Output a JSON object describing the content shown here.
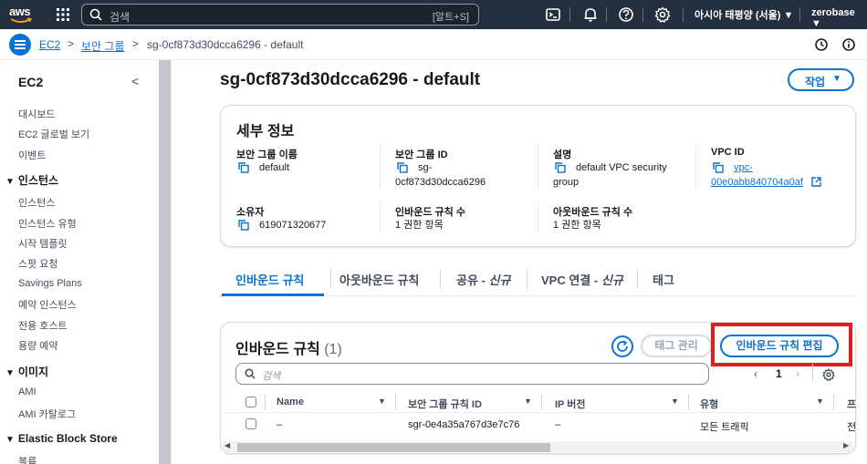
{
  "topnav": {
    "logo": "aws",
    "search_placeholder": "검색",
    "search_shortcut": "[알트+S]",
    "region": "아시아 태평양 (서울)",
    "account": "zerobase",
    "icons": [
      "grid-icon",
      "cloudshell-icon",
      "bell-icon",
      "help-icon",
      "gear-icon"
    ]
  },
  "breadcrumb": {
    "items": [
      "EC2",
      "보안 그룹",
      "sg-0cf873d30dcca6296 - default"
    ]
  },
  "sidebar": {
    "title": "EC2",
    "top_items": [
      "대시보드",
      "EC2 글로벌 보기",
      "이벤트"
    ],
    "sections": [
      {
        "label": "인스턴스",
        "items": [
          "인스턴스",
          "인스턴스 유형",
          "시작 템플릿",
          "스팟 요청",
          "Savings Plans",
          "예약 인스턴스",
          "전용 호스트",
          "용량 예약"
        ]
      },
      {
        "label": "이미지",
        "items": [
          "AMI",
          "AMI 카탈로그"
        ]
      },
      {
        "label": "Elastic Block Store",
        "items": [
          "볼륨"
        ]
      }
    ]
  },
  "main": {
    "title": "sg-0cf873d30dcca6296 - default",
    "action_button": "작업",
    "details": {
      "title": "세부 정보",
      "fields": [
        {
          "label": "보안 그룹 이름",
          "value": "default"
        },
        {
          "label": "보안 그룹 ID",
          "value_lines": [
            "sg-",
            "0cf873d30dcca6296"
          ]
        },
        {
          "label": "설명",
          "value_lines": [
            "default VPC security",
            "group"
          ]
        },
        {
          "label": "VPC ID",
          "value_lines": [
            "vpc-",
            "00e0abb840704a0af"
          ]
        },
        {
          "label": "소유자",
          "value": "619071320677"
        },
        {
          "label": "인바운드 규칙 수",
          "value": "1 권한 항목"
        },
        {
          "label": "아웃바운드 규칙 수",
          "value": "1 권한 항목"
        }
      ]
    },
    "tabs": [
      {
        "label": "인바운드 규칙",
        "suffix": ""
      },
      {
        "label": "아웃바운드 규칙",
        "suffix": ""
      },
      {
        "label": "공유 - ",
        "suffix": "신규"
      },
      {
        "label": "VPC 연결 - ",
        "suffix": "신규"
      },
      {
        "label": "태그",
        "suffix": ""
      }
    ],
    "rules": {
      "title": "인바운드 규칙",
      "count": "(1)",
      "manage_tags_button": "태그 관리",
      "edit_button": "인바운드 규칙 편집",
      "filter_placeholder": "검색",
      "page": "1",
      "columns": [
        "Name",
        "보안 그룹 규칙 ID",
        "IP 버전",
        "유형",
        "프"
      ],
      "rows": [
        {
          "name": "–",
          "rule_id": "sgr-0e4a35a767d3e7c76",
          "ip_version": "–",
          "type": "모든 트래픽",
          "next": "전"
        }
      ]
    }
  },
  "colors": {
    "nav_bg": "#232f3e",
    "link": "#0972d3",
    "highlight": "#e31b23"
  }
}
